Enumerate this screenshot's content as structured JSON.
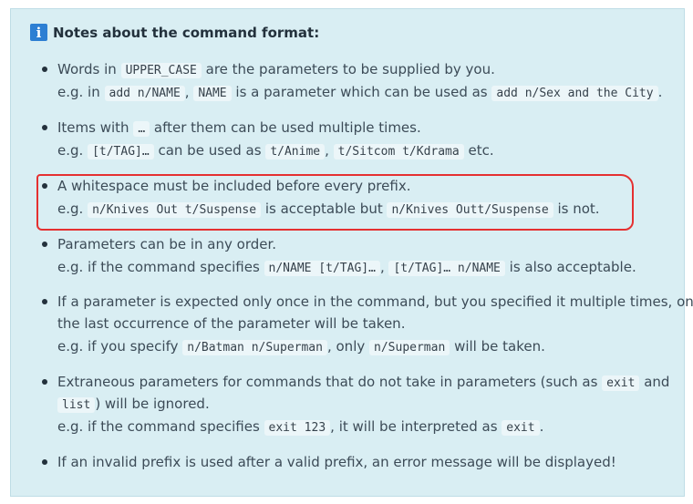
{
  "note": {
    "title": "Notes about the command format:",
    "icon": "info-icon",
    "icon_glyph": "i",
    "colors": {
      "panel_bg": "#d9eef3",
      "icon_bg": "#2d7fd3",
      "highlight": "#e53030",
      "code_bg": "#ecf6f9"
    },
    "items": [
      {
        "line1": {
          "t0": "Words in ",
          "c0": "UPPER_CASE",
          "t1": " are the parameters to be supplied by you."
        },
        "line2": {
          "t0": "e.g. in ",
          "c0": "add n/NAME",
          "t1": ", ",
          "c1": "NAME",
          "t2": " is a parameter which can be used as ",
          "c2": "add n/Sex and the City",
          "t3": "."
        }
      },
      {
        "line1": {
          "t0": "Items with ",
          "c0": "…",
          "t1": " after them can be used multiple times."
        },
        "line2": {
          "t0": "e.g. ",
          "c0": "[t/TAG]…",
          "t1": " can be used as ",
          "c1": "t/Anime",
          "t2": ", ",
          "c2": "t/Sitcom t/Kdrama",
          "t3": " etc."
        }
      },
      {
        "line1": {
          "t0": "A whitespace must be included before every prefix."
        },
        "line2": {
          "t0": "e.g. ",
          "c0": "n/Knives Out t/Suspense",
          "t1": " is acceptable but ",
          "c1": "n/Knives Outt/Suspense",
          "t2": " is not."
        }
      },
      {
        "line1": {
          "t0": "Parameters can be in any order."
        },
        "line2": {
          "t0": "e.g. if the command specifies ",
          "c0": "n/NAME [t/TAG]…",
          "t1": ", ",
          "c1": "[t/TAG]… n/NAME",
          "t2": " is also acceptable."
        }
      },
      {
        "line1": {
          "t0": "If a parameter is expected only once in the command, but you specified it multiple times, only"
        },
        "line2": {
          "t0": "the last occurrence of the parameter will be taken."
        },
        "line3": {
          "t0": "e.g. if you specify ",
          "c0": "n/Batman n/Superman",
          "t1": ", only ",
          "c1": "n/Superman",
          "t2": " will be taken."
        }
      },
      {
        "line1": {
          "t0": "Extraneous parameters for commands that do not take in parameters (such as ",
          "c0": "exit",
          "t1": " and"
        },
        "line2": {
          "c0": "list",
          "t0": ") will be ignored."
        },
        "line3": {
          "t0": "e.g. if the command specifies ",
          "c0": "exit 123",
          "t1": ", it will be interpreted as ",
          "c1": "exit",
          "t2": "."
        }
      },
      {
        "line1": {
          "t0": "If an invalid prefix is used after a valid prefix, an error message will be displayed!"
        }
      }
    ]
  }
}
